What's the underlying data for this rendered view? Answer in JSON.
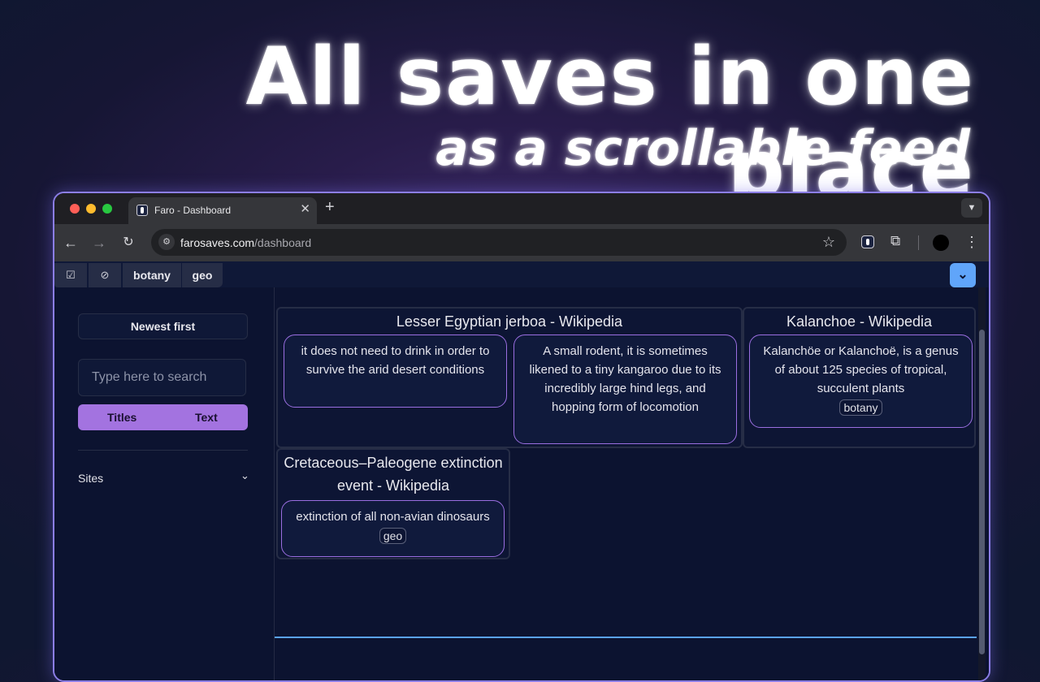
{
  "hero": {
    "title": "All saves in one place",
    "subtitle": "as a scrollable feed"
  },
  "browser": {
    "tab_title": "Faro - Dashboard",
    "url_host": "farosaves.com",
    "url_path": "/dashboard"
  },
  "filters": {
    "tags": [
      "botany",
      "geo"
    ]
  },
  "sidebar": {
    "sort_label": "Newest first",
    "search_placeholder": "Type here to search",
    "toggle_titles": "Titles",
    "toggle_text": "Text",
    "sites_label": "Sites"
  },
  "feed": {
    "groups": [
      {
        "title": "Lesser Egyptian jerboa - Wikipedia",
        "cards": [
          {
            "text": "it does not need to drink in order to survive the arid desert conditions"
          },
          {
            "text": "A small rodent, it is sometimes likened to a tiny kangaroo due to its incredibly large hind legs, and hopping form of locomotion"
          }
        ]
      },
      {
        "title": "Kalanchoe - Wikipedia",
        "cards": [
          {
            "text": "Kalanchöe or Kalanchoë, is a genus of about 125 species of tropical, succulent plants",
            "tag": "botany"
          }
        ]
      },
      {
        "title": "Cretaceous–Paleogene extinction event - Wikipedia",
        "cards": [
          {
            "text": "extinction of all non-avian dinosaurs",
            "tag": "geo"
          }
        ]
      }
    ]
  },
  "colors": {
    "accent": "#a373e0",
    "collapse_button": "#60a5fa",
    "card_border": "#9a6ee0"
  }
}
